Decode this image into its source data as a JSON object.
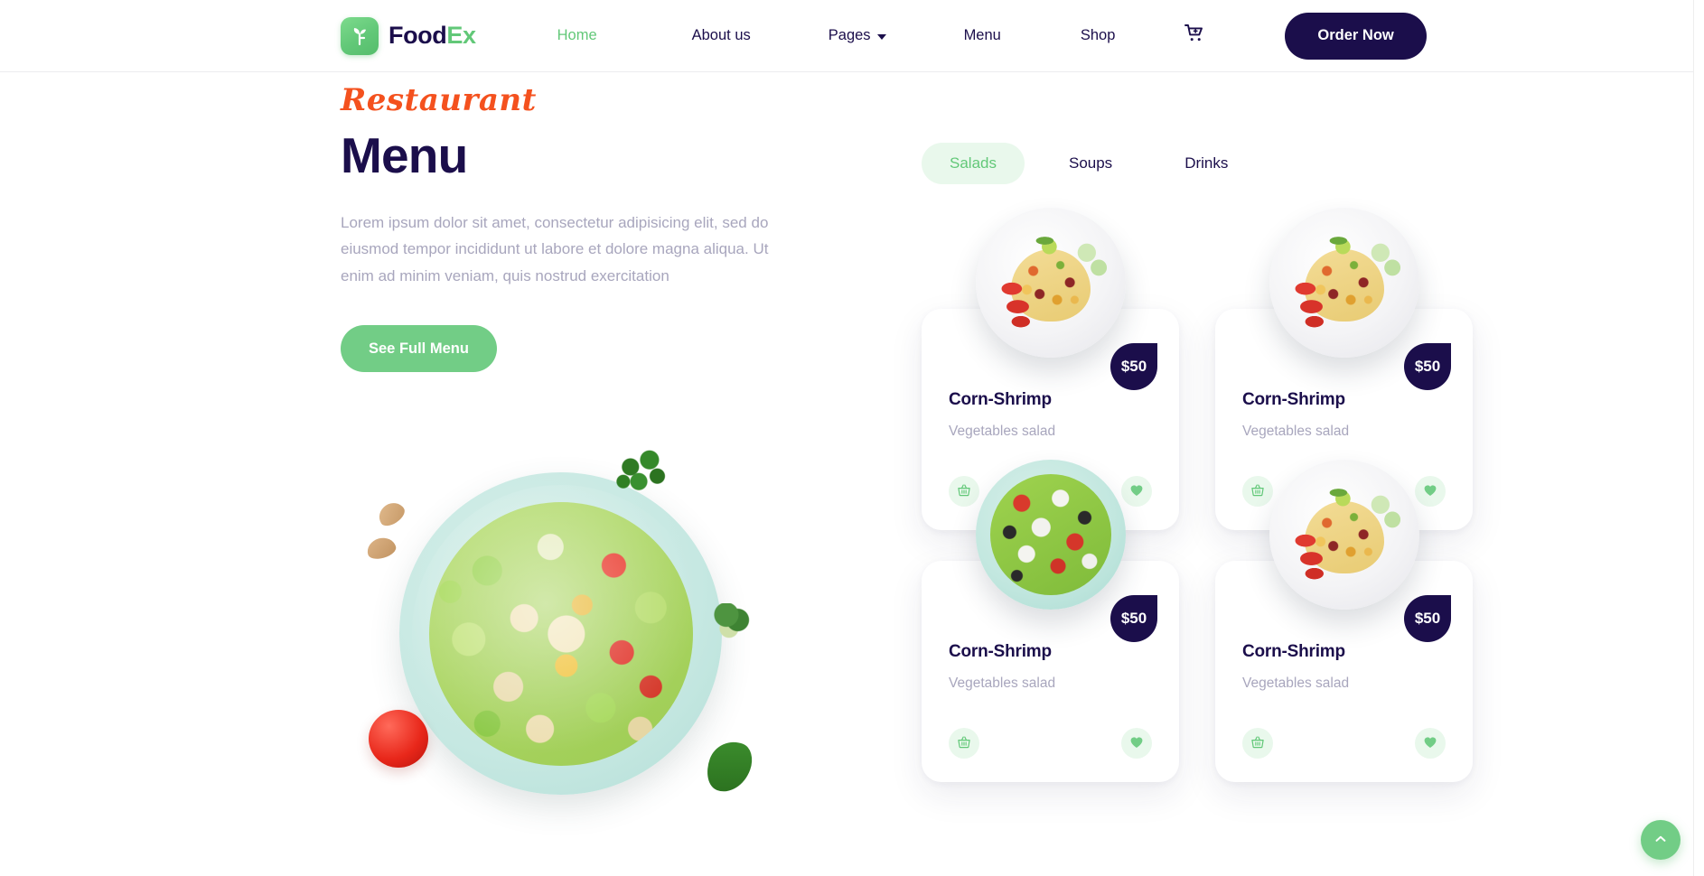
{
  "brand": {
    "name_part1": "Food",
    "name_part2": "Ex",
    "logo_icon": "leaf-sprout-icon",
    "green": "#62c878",
    "navy": "#1b0e4b",
    "orange": "#f4511e"
  },
  "header": {
    "nav": [
      {
        "label": "Home",
        "active": true
      },
      {
        "label": "About us",
        "active": false
      },
      {
        "label": "Pages",
        "active": false,
        "has_dropdown": true
      },
      {
        "label": "Menu",
        "active": false
      },
      {
        "label": "Shop",
        "active": false
      }
    ],
    "cart_icon": "shopping-cart-plus-icon",
    "order_button": "Order Now"
  },
  "hero": {
    "eyebrow": "Restaurant",
    "title": "Menu",
    "description": "Lorem ipsum dolor sit amet, consectetur adipisicing elit, sed do eiusmod tempor incididunt ut labore et dolore magna aliqua. Ut enim ad minim veniam, quis nostrud exercitation",
    "cta_label": "See Full Menu",
    "image_alt": "pasta-vegetable-salad-on-mint-plate"
  },
  "tabs": [
    {
      "label": "Salads",
      "active": true
    },
    {
      "label": "Soups",
      "active": false
    },
    {
      "label": "Drinks",
      "active": false
    }
  ],
  "products": [
    {
      "title": "Corn-Shrimp",
      "subtitle": "Vegetables salad",
      "price": "$50",
      "dish": "rice",
      "cart_icon": "basket-icon",
      "favorite_icon": "heart-icon"
    },
    {
      "title": "Corn-Shrimp",
      "subtitle": "Vegetables salad",
      "price": "$50",
      "dish": "rice",
      "cart_icon": "basket-icon",
      "favorite_icon": "heart-icon"
    },
    {
      "title": "Corn-Shrimp",
      "subtitle": "Vegetables salad",
      "price": "$50",
      "dish": "greek",
      "cart_icon": "basket-icon",
      "favorite_icon": "heart-icon"
    },
    {
      "title": "Corn-Shrimp",
      "subtitle": "Vegetables salad",
      "price": "$50",
      "dish": "rice",
      "cart_icon": "basket-icon",
      "favorite_icon": "heart-icon"
    }
  ],
  "scroll_top": {
    "icon": "chevron-up-icon"
  }
}
